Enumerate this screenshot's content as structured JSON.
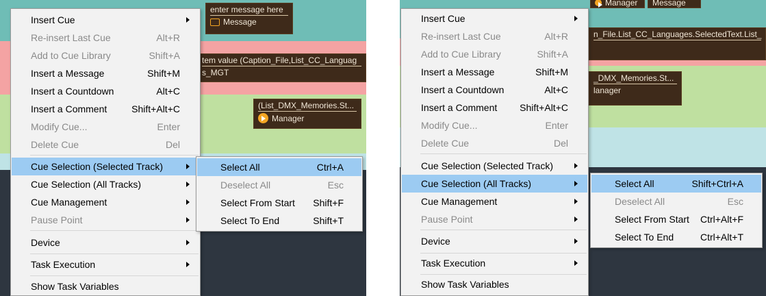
{
  "colors": {
    "teal": "#6fbdb6",
    "pink": "#f4a3a3",
    "green": "#bfe0a0",
    "lightblue": "#bfe3e6",
    "dark": "#2e3640",
    "highlight": "#9ccbf2",
    "menu_bg": "#f2f2f2",
    "cue_bg": "#3e2a1a",
    "accent_orange": "#f5a623"
  },
  "left": {
    "bg_cues": {
      "c1_line": "enter message here",
      "c1_label": "Message",
      "c2_line": "tem value (Caption_File,List_CC_Languag",
      "c2_text": "s_MGT",
      "c3_line": "(List_DMX_Memories.St...",
      "c3_label": "Manager"
    },
    "menu": {
      "insert_cue": "Insert Cue",
      "reinsert": "Re-insert Last Cue",
      "reinsert_sc": "Alt+R",
      "add_library": "Add to Cue Library",
      "add_library_sc": "Shift+A",
      "insert_message": "Insert a Message",
      "insert_message_sc": "Shift+M",
      "insert_countdown": "Insert a Countdown",
      "insert_countdown_sc": "Alt+C",
      "insert_comment": "Insert a Comment",
      "insert_comment_sc": "Shift+Alt+C",
      "modify": "Modify Cue...",
      "modify_sc": "Enter",
      "delete": "Delete Cue",
      "delete_sc": "Del",
      "sel_track": "Cue Selection (Selected Track)",
      "sel_all_tracks": "Cue Selection (All Tracks)",
      "management": "Cue Management",
      "pause": "Pause Point",
      "device": "Device",
      "task_exec": "Task Execution",
      "show_vars": "Show Task Variables"
    },
    "submenu": {
      "select_all": "Select All",
      "select_all_sc": "Ctrl+A",
      "deselect_all": "Deselect All",
      "deselect_all_sc": "Esc",
      "from_start": "Select From Start",
      "from_start_sc": "Shift+F",
      "to_end": "Select To End",
      "to_end_sc": "Shift+T"
    }
  },
  "right": {
    "bg_cues": {
      "c0_a": "Manager",
      "c0_b": "Message",
      "c1_line": "n_File.List_CC_Languages.SelectedText.List_",
      "c2_line": "_DMX_Memories.St...",
      "c2_label": "lanager"
    },
    "menu": {
      "insert_cue": "Insert Cue",
      "reinsert": "Re-insert Last Cue",
      "reinsert_sc": "Alt+R",
      "add_library": "Add to Cue Library",
      "add_library_sc": "Shift+A",
      "insert_message": "Insert a Message",
      "insert_message_sc": "Shift+M",
      "insert_countdown": "Insert a Countdown",
      "insert_countdown_sc": "Alt+C",
      "insert_comment": "Insert a Comment",
      "insert_comment_sc": "Shift+Alt+C",
      "modify": "Modify Cue...",
      "modify_sc": "Enter",
      "delete": "Delete Cue",
      "delete_sc": "Del",
      "sel_track": "Cue Selection (Selected Track)",
      "sel_all_tracks": "Cue Selection (All Tracks)",
      "management": "Cue Management",
      "pause": "Pause Point",
      "device": "Device",
      "task_exec": "Task Execution",
      "show_vars": "Show Task Variables"
    },
    "submenu": {
      "select_all": "Select All",
      "select_all_sc": "Shift+Ctrl+A",
      "deselect_all": "Deselect All",
      "deselect_all_sc": "Esc",
      "from_start": "Select From Start",
      "from_start_sc": "Ctrl+Alt+F",
      "to_end": "Select To End",
      "to_end_sc": "Ctrl+Alt+T"
    }
  }
}
